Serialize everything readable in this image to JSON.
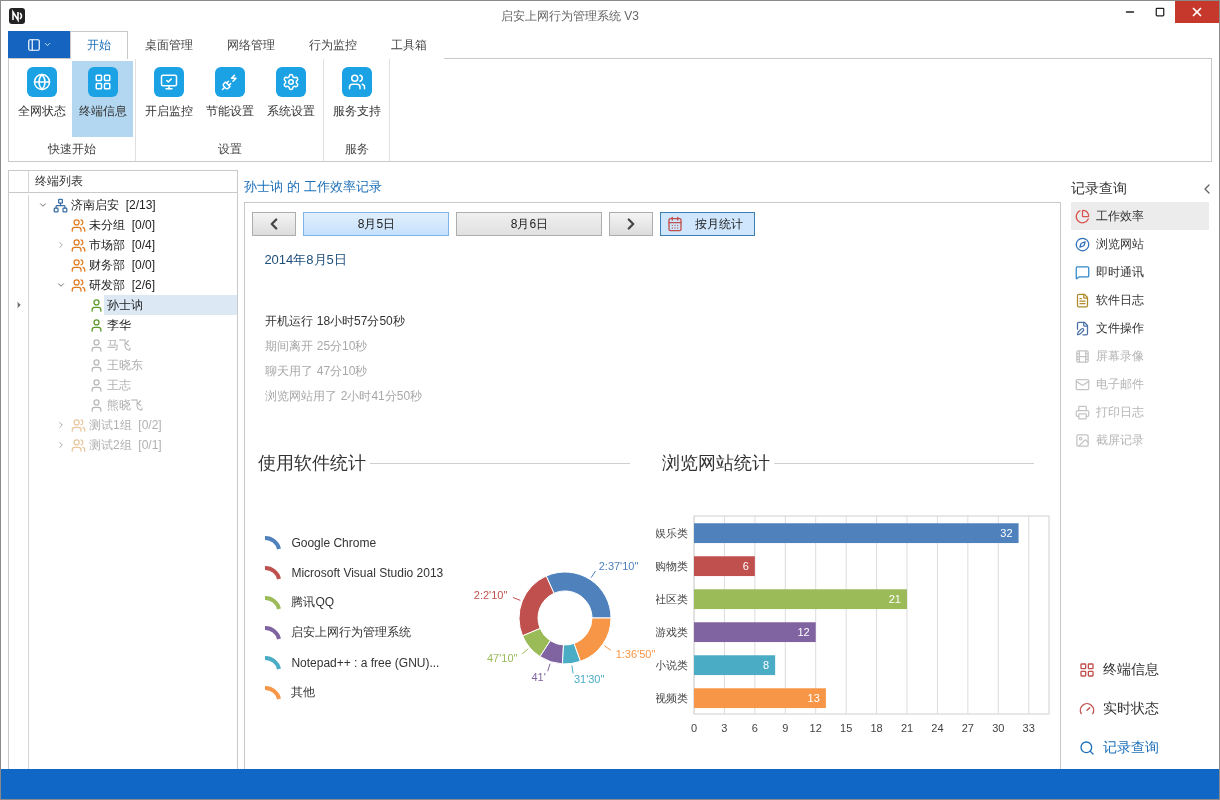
{
  "window": {
    "title": "启安上网行为管理系统 V3"
  },
  "ribbon": {
    "tabs": [
      {
        "label": "开始",
        "selected": true
      },
      {
        "label": "桌面管理",
        "selected": false
      },
      {
        "label": "网络管理",
        "selected": false
      },
      {
        "label": "行为监控",
        "selected": false
      },
      {
        "label": "工具箱",
        "selected": false
      }
    ],
    "groups": [
      {
        "label": "快速开始",
        "buttons": [
          {
            "label": "全网状态",
            "selected": false
          },
          {
            "label": "终端信息",
            "selected": true
          }
        ]
      },
      {
        "label": "设置",
        "buttons": [
          {
            "label": "开启监控",
            "selected": false
          },
          {
            "label": "节能设置",
            "selected": false
          },
          {
            "label": "系统设置",
            "selected": false
          }
        ]
      },
      {
        "label": "服务",
        "buttons": [
          {
            "label": "服务支持",
            "selected": false
          }
        ]
      }
    ]
  },
  "terminal_tree": {
    "header": "终端列表",
    "nodes": [
      {
        "label": "济南启安",
        "count": "[2/13]",
        "kind": "org",
        "expanded": true,
        "selected": false,
        "disabled": false,
        "children": [
          {
            "label": "未分组",
            "count": "[0/0]",
            "kind": "group",
            "selected": false,
            "disabled": false
          },
          {
            "label": "市场部",
            "count": "[0/4]",
            "kind": "group",
            "expanded": false,
            "selected": false,
            "disabled": false
          },
          {
            "label": "财务部",
            "count": "[0/0]",
            "kind": "group",
            "selected": false,
            "disabled": false
          },
          {
            "label": "研发部",
            "count": "[2/6]",
            "kind": "group",
            "expanded": true,
            "selected": false,
            "disabled": false,
            "children": [
              {
                "label": "孙士讷",
                "kind": "user",
                "selected": true,
                "disabled": false
              },
              {
                "label": "李华",
                "kind": "user",
                "selected": false,
                "disabled": false
              },
              {
                "label": "马飞",
                "kind": "user",
                "selected": false,
                "disabled": true
              },
              {
                "label": "王晓东",
                "kind": "user",
                "selected": false,
                "disabled": true
              },
              {
                "label": "王志",
                "kind": "user",
                "selected": false,
                "disabled": true
              },
              {
                "label": "熊晓飞",
                "kind": "user",
                "selected": false,
                "disabled": true
              }
            ]
          },
          {
            "label": "测试1组",
            "count": "[0/2]",
            "kind": "group",
            "expanded": false,
            "selected": false,
            "disabled": true
          },
          {
            "label": "测试2组",
            "count": "[0/1]",
            "kind": "group",
            "expanded": false,
            "selected": false,
            "disabled": true
          }
        ]
      }
    ]
  },
  "record": {
    "title": "孙士讷 的 工作效率记录",
    "days": [
      {
        "label": "8月5日",
        "selected": true
      },
      {
        "label": "8月6日",
        "selected": false
      }
    ],
    "month_button": {
      "label": "按月统计",
      "selected": true
    },
    "date": "2014年8月5日",
    "stats": [
      {
        "text": "开机运行 18小时57分50秒",
        "dimmed": false
      },
      {
        "text": "期间离开 25分10秒",
        "dimmed": true
      },
      {
        "text": "聊天用了 47分10秒",
        "dimmed": true
      },
      {
        "text": "浏览网站用了 2小时41分50秒",
        "dimmed": true
      }
    ],
    "software_stats": {
      "title": "使用软件统计",
      "chart_data": {
        "type": "donut",
        "categories": [
          "Google Chrome",
          "Microsoft Visual Studio 2013",
          "腾讯QQ",
          "启安上网行为管理系统",
          "Notepad++ : a free (GNU)...",
          "其他"
        ],
        "values": [
          157.17,
          122.17,
          47.17,
          41,
          31.5,
          96.83
        ],
        "colors": [
          "#4f81bd",
          "#c0504d",
          "#9bbb59",
          "#8064a2",
          "#4bacc6",
          "#f79646"
        ],
        "value_labels": [
          "2:37'10\"",
          "2:2'10\"",
          "47'10\"",
          "41'",
          "31'30\"",
          "1:36'50\""
        ]
      }
    },
    "website_stats": {
      "title": "浏览网站统计",
      "chart_data": {
        "type": "bar",
        "orientation": "horizontal",
        "categories": [
          "娱乐类",
          "购物类",
          "社区类",
          "游戏类",
          "小说类",
          "视频类"
        ],
        "values": [
          32,
          6,
          21,
          12,
          8,
          13
        ],
        "colors": [
          "#4f81bd",
          "#c0504d",
          "#9bbb59",
          "#8064a2",
          "#4bacc6",
          "#f79646"
        ],
        "xlim": [
          0,
          35
        ],
        "grid": true,
        "xticks": [
          0,
          3,
          6,
          9,
          12,
          15,
          18,
          21,
          24,
          27,
          30,
          33
        ],
        "data_labels": true
      }
    }
  },
  "record_panel": {
    "title": "记录查询",
    "items": [
      {
        "label": "工作效率",
        "selected": true,
        "disabled": false
      },
      {
        "label": "浏览网站",
        "selected": false,
        "disabled": false
      },
      {
        "label": "即时通讯",
        "selected": false,
        "disabled": false
      },
      {
        "label": "软件日志",
        "selected": false,
        "disabled": false
      },
      {
        "label": "文件操作",
        "selected": false,
        "disabled": false
      },
      {
        "label": "屏幕录像",
        "selected": false,
        "disabled": true
      },
      {
        "label": "电子邮件",
        "selected": false,
        "disabled": true
      },
      {
        "label": "打印日志",
        "selected": false,
        "disabled": true
      },
      {
        "label": "截屏记录",
        "selected": false,
        "disabled": true
      }
    ],
    "nav": [
      {
        "label": "终端信息",
        "selected": false
      },
      {
        "label": "实时状态",
        "selected": false
      },
      {
        "label": "记录查询",
        "selected": true
      }
    ]
  }
}
